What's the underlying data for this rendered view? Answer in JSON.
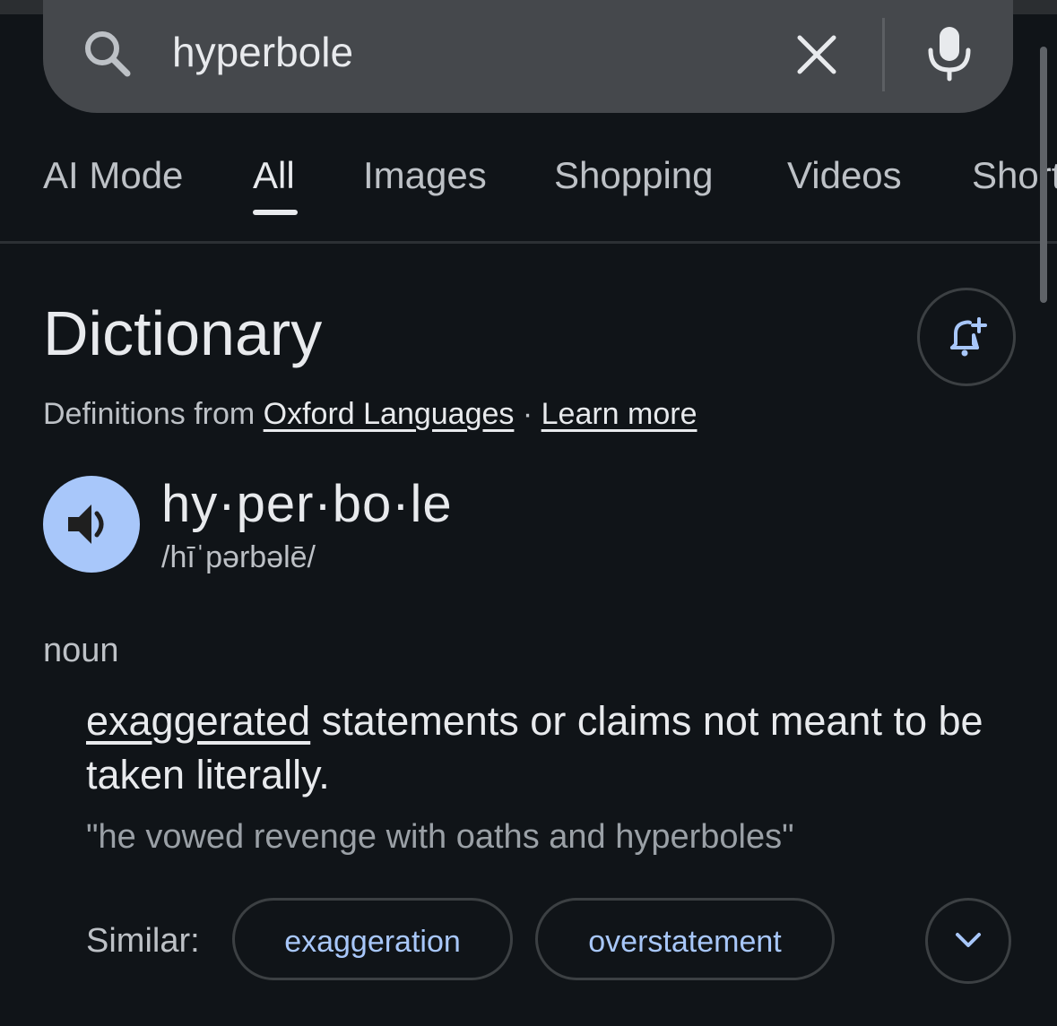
{
  "search": {
    "query": "hyperbole",
    "icons": {
      "search": "search-icon",
      "clear": "close-icon",
      "voice": "mic-icon"
    }
  },
  "tabs": [
    {
      "label": "AI Mode",
      "active": false
    },
    {
      "label": "All",
      "active": true
    },
    {
      "label": "Images",
      "active": false
    },
    {
      "label": "Shopping",
      "active": false
    },
    {
      "label": "Videos",
      "active": false
    },
    {
      "label": "Short",
      "active": false
    }
  ],
  "dictionary": {
    "title": "Dictionary",
    "source_prefix": "Definitions from ",
    "source_link": "Oxford Languages",
    "separator": " · ",
    "learn_more": "Learn more",
    "alert_icon": "notification-add-icon",
    "word": "hy·per·bo·le",
    "pronunciation": "/hīˈpərbəlē/",
    "speaker_icon": "speaker-icon",
    "part_of_speech": "noun",
    "definition_link": "exaggerated",
    "definition_rest": " statements or claims not meant to be taken literally.",
    "example": "\"he vowed revenge with oaths and hyperboles\"",
    "similar_label": "Similar:",
    "similar": [
      "exaggeration",
      "overstatement"
    ],
    "expand_icon": "chevron-down-icon"
  },
  "colors": {
    "background": "#101418",
    "search_bg": "#45484c",
    "accent": "#a8c7fa",
    "text": "#e8eaed",
    "muted": "#bdc1c6"
  }
}
